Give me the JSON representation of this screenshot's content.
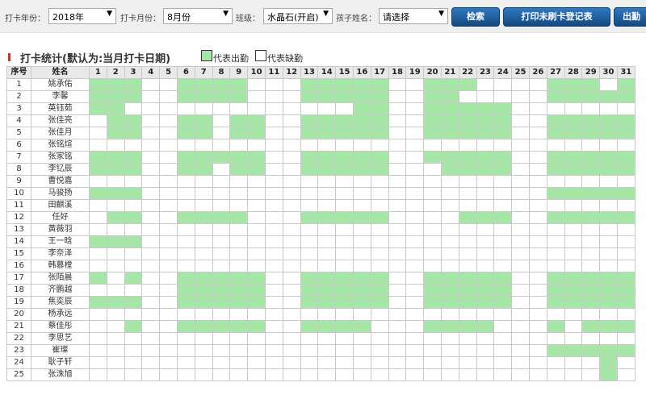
{
  "filters": {
    "year_label": "打卡年份：",
    "year_value": "2018年",
    "month_label": "打卡月份：",
    "month_value": "8月份",
    "class_label": "班级：",
    "class_value": "水晶石(开启)",
    "child_label": "孩子姓名：",
    "child_value": "请选择"
  },
  "buttons": {
    "search": "检索",
    "print": "打印未刷卡登记表",
    "export": "出勤"
  },
  "section": {
    "title": "打卡统计(默认为:当月打卡日期)",
    "legend_present": "代表出勤",
    "legend_absent": "代表缺勤"
  },
  "colors": {
    "present": "#a6e6a6",
    "absent": "#ffffff",
    "button": "#1f5fa3"
  },
  "table": {
    "col_index": "序号",
    "col_name": "姓名",
    "days": [
      "1",
      "2",
      "3",
      "4",
      "5",
      "6",
      "7",
      "8",
      "9",
      "10",
      "11",
      "12",
      "13",
      "14",
      "15",
      "16",
      "17",
      "18",
      "19",
      "20",
      "21",
      "22",
      "23",
      "24",
      "25",
      "26",
      "27",
      "28",
      "29",
      "30",
      "31"
    ],
    "rows": [
      {
        "index": "1",
        "name": "姚承佑",
        "present": [
          1,
          2,
          3,
          6,
          7,
          8,
          9,
          13,
          14,
          15,
          16,
          17,
          20,
          21,
          22,
          27,
          28,
          29,
          31
        ]
      },
      {
        "index": "2",
        "name": "李馨",
        "present": [
          1,
          2,
          3,
          6,
          7,
          8,
          9,
          13,
          14,
          15,
          16,
          17,
          20,
          21,
          27,
          28,
          29,
          30,
          31
        ]
      },
      {
        "index": "3",
        "name": "英钰茹",
        "present": [
          1,
          2,
          16,
          17,
          20,
          21,
          22,
          23,
          24
        ]
      },
      {
        "index": "4",
        "name": "张佳亮",
        "present": [
          2,
          3,
          6,
          7,
          9,
          10,
          13,
          14,
          15,
          16,
          17,
          20,
          21,
          22,
          23,
          24,
          27,
          28,
          29,
          30,
          31
        ]
      },
      {
        "index": "5",
        "name": "张佳月",
        "present": [
          2,
          3,
          6,
          7,
          9,
          10,
          13,
          14,
          15,
          16,
          17,
          20,
          21,
          22,
          23,
          24,
          27,
          28,
          29,
          30,
          31
        ]
      },
      {
        "index": "6",
        "name": "张铭煊",
        "present": []
      },
      {
        "index": "7",
        "name": "张家铭",
        "present": [
          1,
          2,
          3,
          6,
          7,
          8,
          9,
          10,
          13,
          14,
          15,
          16,
          17,
          20,
          21,
          22,
          23,
          24,
          27,
          28,
          29,
          30,
          31
        ]
      },
      {
        "index": "8",
        "name": "李钇辰",
        "present": [
          1,
          2,
          3,
          6,
          7,
          9,
          10,
          13,
          14,
          15,
          16,
          17,
          21,
          22,
          23,
          24,
          27,
          28,
          29,
          30,
          31
        ]
      },
      {
        "index": "9",
        "name": "曹悦嘉",
        "present": []
      },
      {
        "index": "10",
        "name": "马骏扬",
        "present": [
          1,
          2,
          3,
          27,
          28,
          29,
          30,
          31
        ]
      },
      {
        "index": "11",
        "name": "田麒溪",
        "present": []
      },
      {
        "index": "12",
        "name": "任好",
        "present": [
          2,
          3,
          6,
          7,
          8,
          9,
          13,
          14,
          15,
          16,
          17,
          22,
          23,
          24,
          27,
          28,
          29,
          30,
          31
        ]
      },
      {
        "index": "13",
        "name": "黄薇羽",
        "present": []
      },
      {
        "index": "14",
        "name": "王一晗",
        "present": [
          1,
          2,
          3
        ]
      },
      {
        "index": "15",
        "name": "李奈泽",
        "present": []
      },
      {
        "index": "16",
        "name": "韩慕樘",
        "present": []
      },
      {
        "index": "17",
        "name": "张陌晨",
        "present": [
          1,
          3,
          6,
          7,
          8,
          9,
          10,
          13,
          14,
          15,
          16,
          17,
          20,
          21,
          22,
          23,
          24,
          27,
          28,
          29,
          30,
          31
        ]
      },
      {
        "index": "18",
        "name": "齐鹏越",
        "present": [
          6,
          7,
          8,
          9,
          10,
          13,
          14,
          15,
          16,
          17,
          20,
          21,
          22,
          23,
          24,
          27,
          28,
          29,
          30,
          31
        ]
      },
      {
        "index": "19",
        "name": "焦奕辰",
        "present": [
          1,
          2,
          3,
          6,
          7,
          8,
          9,
          10,
          13,
          14,
          15,
          16,
          17,
          20,
          21,
          22,
          23,
          24,
          27,
          28,
          29,
          30,
          31
        ]
      },
      {
        "index": "20",
        "name": "杨承远",
        "present": []
      },
      {
        "index": "21",
        "name": "蔡佳彤",
        "present": [
          3,
          6,
          7,
          8,
          9,
          10,
          13,
          14,
          15,
          16,
          20,
          21,
          22,
          23,
          27,
          29,
          30,
          31
        ]
      },
      {
        "index": "22",
        "name": "李思艺",
        "present": []
      },
      {
        "index": "23",
        "name": "崔璨",
        "present": [
          27,
          28,
          29,
          30,
          31
        ]
      },
      {
        "index": "24",
        "name": "耿子轩",
        "present": [
          30
        ]
      },
      {
        "index": "25",
        "name": "张洙旭",
        "present": [
          30
        ]
      }
    ]
  }
}
